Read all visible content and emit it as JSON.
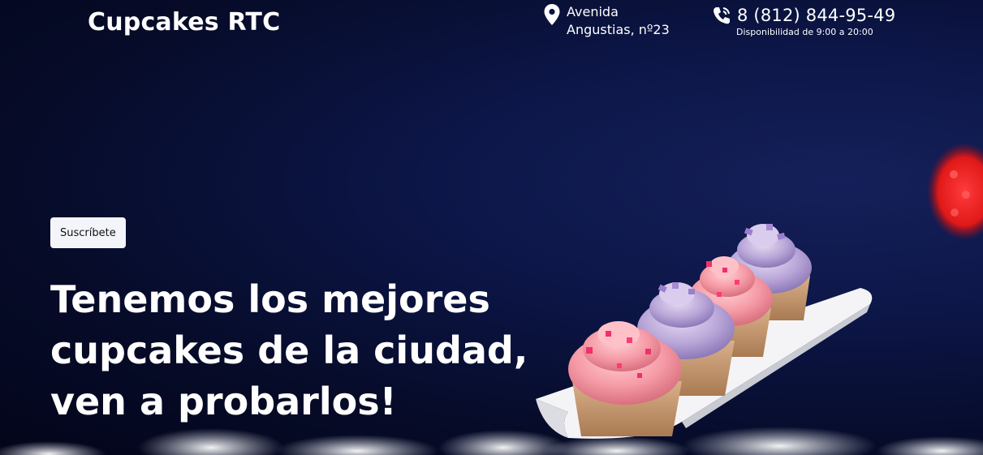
{
  "header": {
    "brand": "Cupcakes RTC",
    "address_line1": "Avenida",
    "address_line2": "Angustias, nº23",
    "phone": "8 (812) 844-95-49",
    "hours": "Disponibilidad de 9:00 a 20:00",
    "icons": [
      "map-pin-icon",
      "phone-icon"
    ]
  },
  "hero": {
    "subscribe_label": "Suscríbete",
    "headline_line1": "Tenemos los mejores",
    "headline_line2": "cupcakes de la ciudad,",
    "headline_line3": "ven a probarlos!"
  },
  "colors": {
    "background": "#0c1647",
    "text": "#ffffff",
    "button_bg": "#f4f5fb"
  }
}
